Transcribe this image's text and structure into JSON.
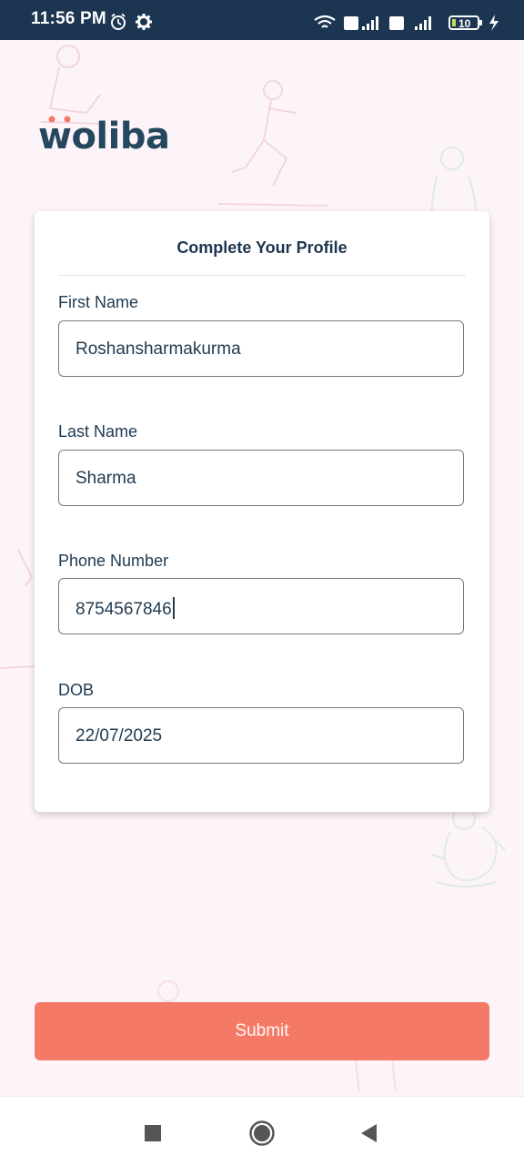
{
  "status_bar": {
    "time": "11:56 PM",
    "left_icons": [
      "alarm-icon",
      "gear-icon"
    ],
    "right_icons": [
      "wifi-icon",
      "volte-icon",
      "signal-icon",
      "volte-icon",
      "4g-signal-icon",
      "battery-icon",
      "charging-icon"
    ],
    "battery_level": "10"
  },
  "brand": {
    "name": "woliba"
  },
  "form": {
    "title": "Complete Your Profile",
    "fields": [
      {
        "label": "First Name",
        "value": "Roshansharmakurma"
      },
      {
        "label": "Last Name",
        "value": "Sharma"
      },
      {
        "label": "Phone Number",
        "value": "8754567846"
      },
      {
        "label": "DOB",
        "value": "22/07/2025"
      }
    ]
  },
  "submit": {
    "label": "Submit"
  },
  "nav_bar": {
    "buttons": [
      "recents-square-icon",
      "home-circle-icon",
      "back-triangle-icon"
    ]
  },
  "colors": {
    "status_bar": "#1c3550",
    "accent": "#f47a67",
    "text_dark": "#1d3650",
    "background": "#fdf4fa"
  }
}
